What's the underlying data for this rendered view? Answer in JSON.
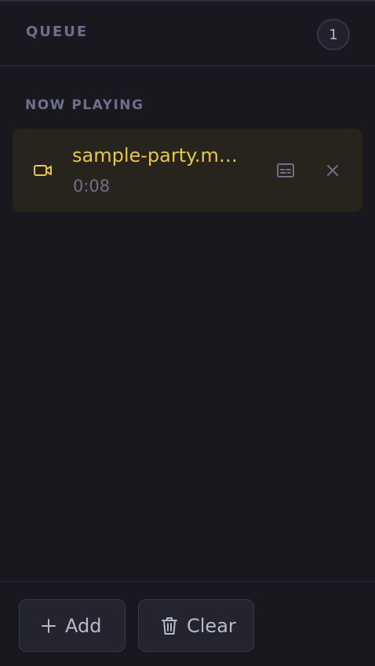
{
  "header": {
    "title": "QUEUE",
    "count": "1"
  },
  "now_playing": {
    "section_label": "NOW PLAYING",
    "item": {
      "title": "sample-party.m…",
      "duration": "0:08",
      "icon": "video-camera-icon"
    }
  },
  "footer": {
    "add_label": "Add",
    "clear_label": "Clear"
  },
  "colors": {
    "background": "#18181e",
    "accent": "#e8c64a",
    "active_item_bg": "#27241d",
    "muted_text": "#6f6f8a"
  }
}
